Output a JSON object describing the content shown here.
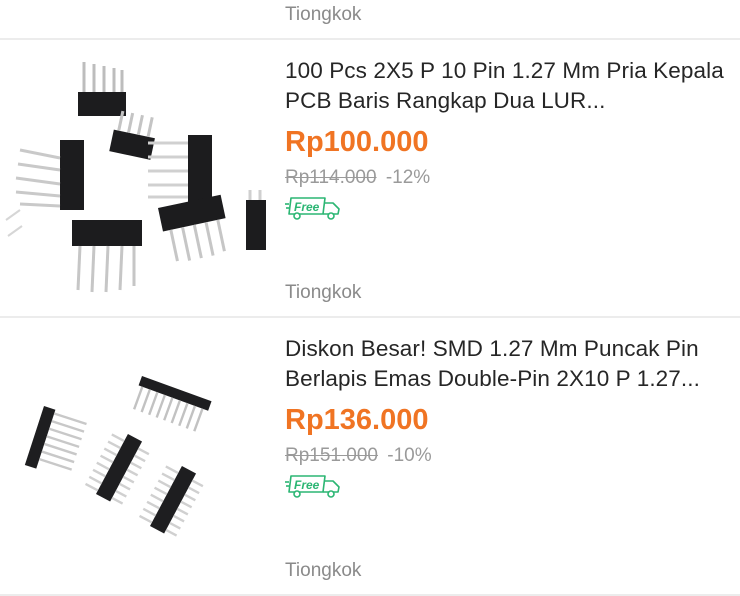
{
  "previous_item": {
    "location": "Tiongkok"
  },
  "products": [
    {
      "title": "100 Pcs 2X5 P 10 Pin 1.27 Mm Pria Kepala PCB Baris Rangkap Dua LUR...",
      "price": "Rp100.000",
      "original_price": "Rp114.000",
      "discount": "-12%",
      "shipping_badge": "Free",
      "location": "Tiongkok",
      "image_icon": "right-angle-pin-header-image"
    },
    {
      "title": "Diskon Besar! SMD 1.27 Mm Puncak Pin Berlapis Emas Double-Pin 2X10 P 1.27...",
      "price": "Rp136.000",
      "original_price": "Rp151.000",
      "discount": "-10%",
      "shipping_badge": "Free",
      "location": "Tiongkok",
      "image_icon": "smd-pin-header-image"
    }
  ],
  "colors": {
    "price": "#f07423",
    "free_badge": "#2bb673",
    "muted": "#8a8a8a",
    "divider": "#ececec"
  }
}
